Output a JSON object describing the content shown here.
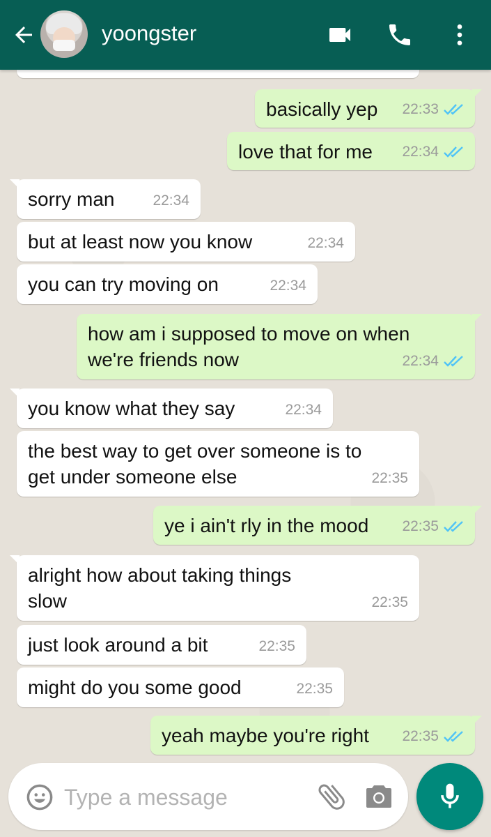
{
  "header": {
    "contact_name": "yoongster",
    "back_icon": "arrow-left-icon",
    "video_icon": "video-camera-icon",
    "call_icon": "phone-icon",
    "menu_icon": "more-vertical-icon",
    "bg_color": "#075e54"
  },
  "messages": [
    {
      "dir": "out",
      "text": "basically yep",
      "time": "22:33",
      "status": "read"
    },
    {
      "dir": "out",
      "text": "love that for me",
      "time": "22:34",
      "status": "read"
    },
    {
      "dir": "in",
      "text": "sorry man",
      "time": "22:34"
    },
    {
      "dir": "in",
      "text": "but at least now you know",
      "time": "22:34"
    },
    {
      "dir": "in",
      "text": "you can try moving on",
      "time": "22:34"
    },
    {
      "dir": "out",
      "text": "how am i supposed to move on when",
      "text2": "we're friends now",
      "time": "22:34",
      "status": "read"
    },
    {
      "dir": "in",
      "text": "you know what they say",
      "time": "22:34"
    },
    {
      "dir": "in",
      "text": "the best way to get over someone is to",
      "text2": "get under someone else",
      "time": "22:35"
    },
    {
      "dir": "out",
      "text": "ye i ain't rly in the mood",
      "time": "22:35",
      "status": "read"
    },
    {
      "dir": "in",
      "text": "alright how about taking things",
      "text2": "slow",
      "time": "22:35"
    },
    {
      "dir": "in",
      "text": "just look around a bit",
      "time": "22:35"
    },
    {
      "dir": "in",
      "text": "might do you some good",
      "time": "22:35"
    },
    {
      "dir": "out",
      "text": "yeah maybe you're right",
      "time": "22:35",
      "status": "read"
    }
  ],
  "composer": {
    "placeholder": "Type a message",
    "emoji_icon": "smiley-icon",
    "attach_icon": "paperclip-icon",
    "camera_icon": "camera-icon",
    "mic_icon": "microphone-icon",
    "accent_color": "#00897b"
  },
  "colors": {
    "outgoing_bubble": "#dcf8c6",
    "incoming_bubble": "#ffffff",
    "read_tick": "#4fc3f7"
  }
}
